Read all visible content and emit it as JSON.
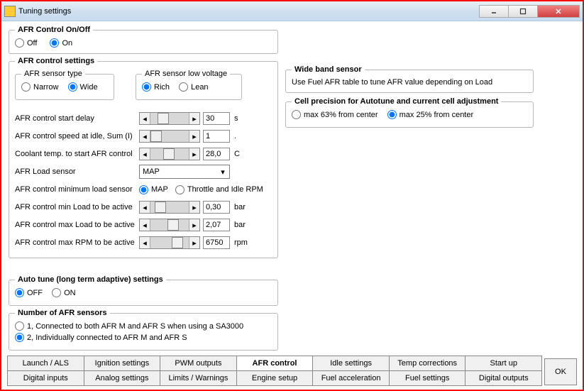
{
  "window": {
    "title": "Tuning settings"
  },
  "afr_onoff": {
    "legend": "AFR Control On/Off",
    "off": "Off",
    "on": "On",
    "selected": "on"
  },
  "afr_settings": {
    "legend": "AFR control settings",
    "sensor_type": {
      "legend": "AFR sensor type",
      "narrow": "Narrow",
      "wide": "Wide",
      "selected": "wide"
    },
    "low_voltage": {
      "legend": "AFR sensor low voltage",
      "rich": "Rich",
      "lean": "Lean",
      "selected": "rich"
    },
    "rows": {
      "start_delay": {
        "label": "AFR control start delay",
        "value": "30",
        "unit": "s"
      },
      "idle_speed": {
        "label": "AFR control speed at idle, Sum (I)",
        "value": "1",
        "unit": "."
      },
      "coolant": {
        "label": "Coolant temp. to start AFR control",
        "value": "28,0",
        "unit": "C"
      },
      "load_sensor": {
        "label": "AFR Load sensor",
        "value": "MAP"
      },
      "min_load_sensor": {
        "label": "AFR control minimum load sensor",
        "map": "MAP",
        "throttle": "Throttle and Idle RPM",
        "selected": "map"
      },
      "min_load": {
        "label": "AFR control min Load to be active",
        "value": "0,30",
        "unit": "bar"
      },
      "max_load": {
        "label": "AFR control max Load to be active",
        "value": "2,07",
        "unit": "bar"
      },
      "max_rpm": {
        "label": "AFR control max RPM to be active",
        "value": "6750",
        "unit": "rpm"
      }
    }
  },
  "wide_band": {
    "legend": "Wide band sensor",
    "text": "Use Fuel AFR table to tune AFR value depending on Load"
  },
  "cell_precision": {
    "legend": "Cell precision for Autotune and current cell adjustment",
    "opt63": "max 63% from center",
    "opt25": "max 25% from center",
    "selected": "25"
  },
  "autotune": {
    "legend": "Auto tune (long term adaptive) settings",
    "off": "OFF",
    "on": "ON",
    "selected": "off"
  },
  "num_sensors": {
    "legend": "Number of AFR sensors",
    "opt1": "1, Connected to both AFR M and AFR S when using a SA3000",
    "opt2": "2, Individually connected to AFR M and AFR S",
    "selected": "2"
  },
  "tabs": {
    "row1": [
      "Launch / ALS",
      "Ignition settings",
      "PWM outputs",
      "AFR control",
      "Idle settings",
      "Temp corrections",
      "Start up"
    ],
    "row2": [
      "Digital inputs",
      "Analog settings",
      "Limits / Warnings",
      "Engine setup",
      "Fuel acceleration",
      "Fuel settings",
      "Digital outputs"
    ],
    "active": "AFR control"
  },
  "button": {
    "ok": "OK"
  }
}
